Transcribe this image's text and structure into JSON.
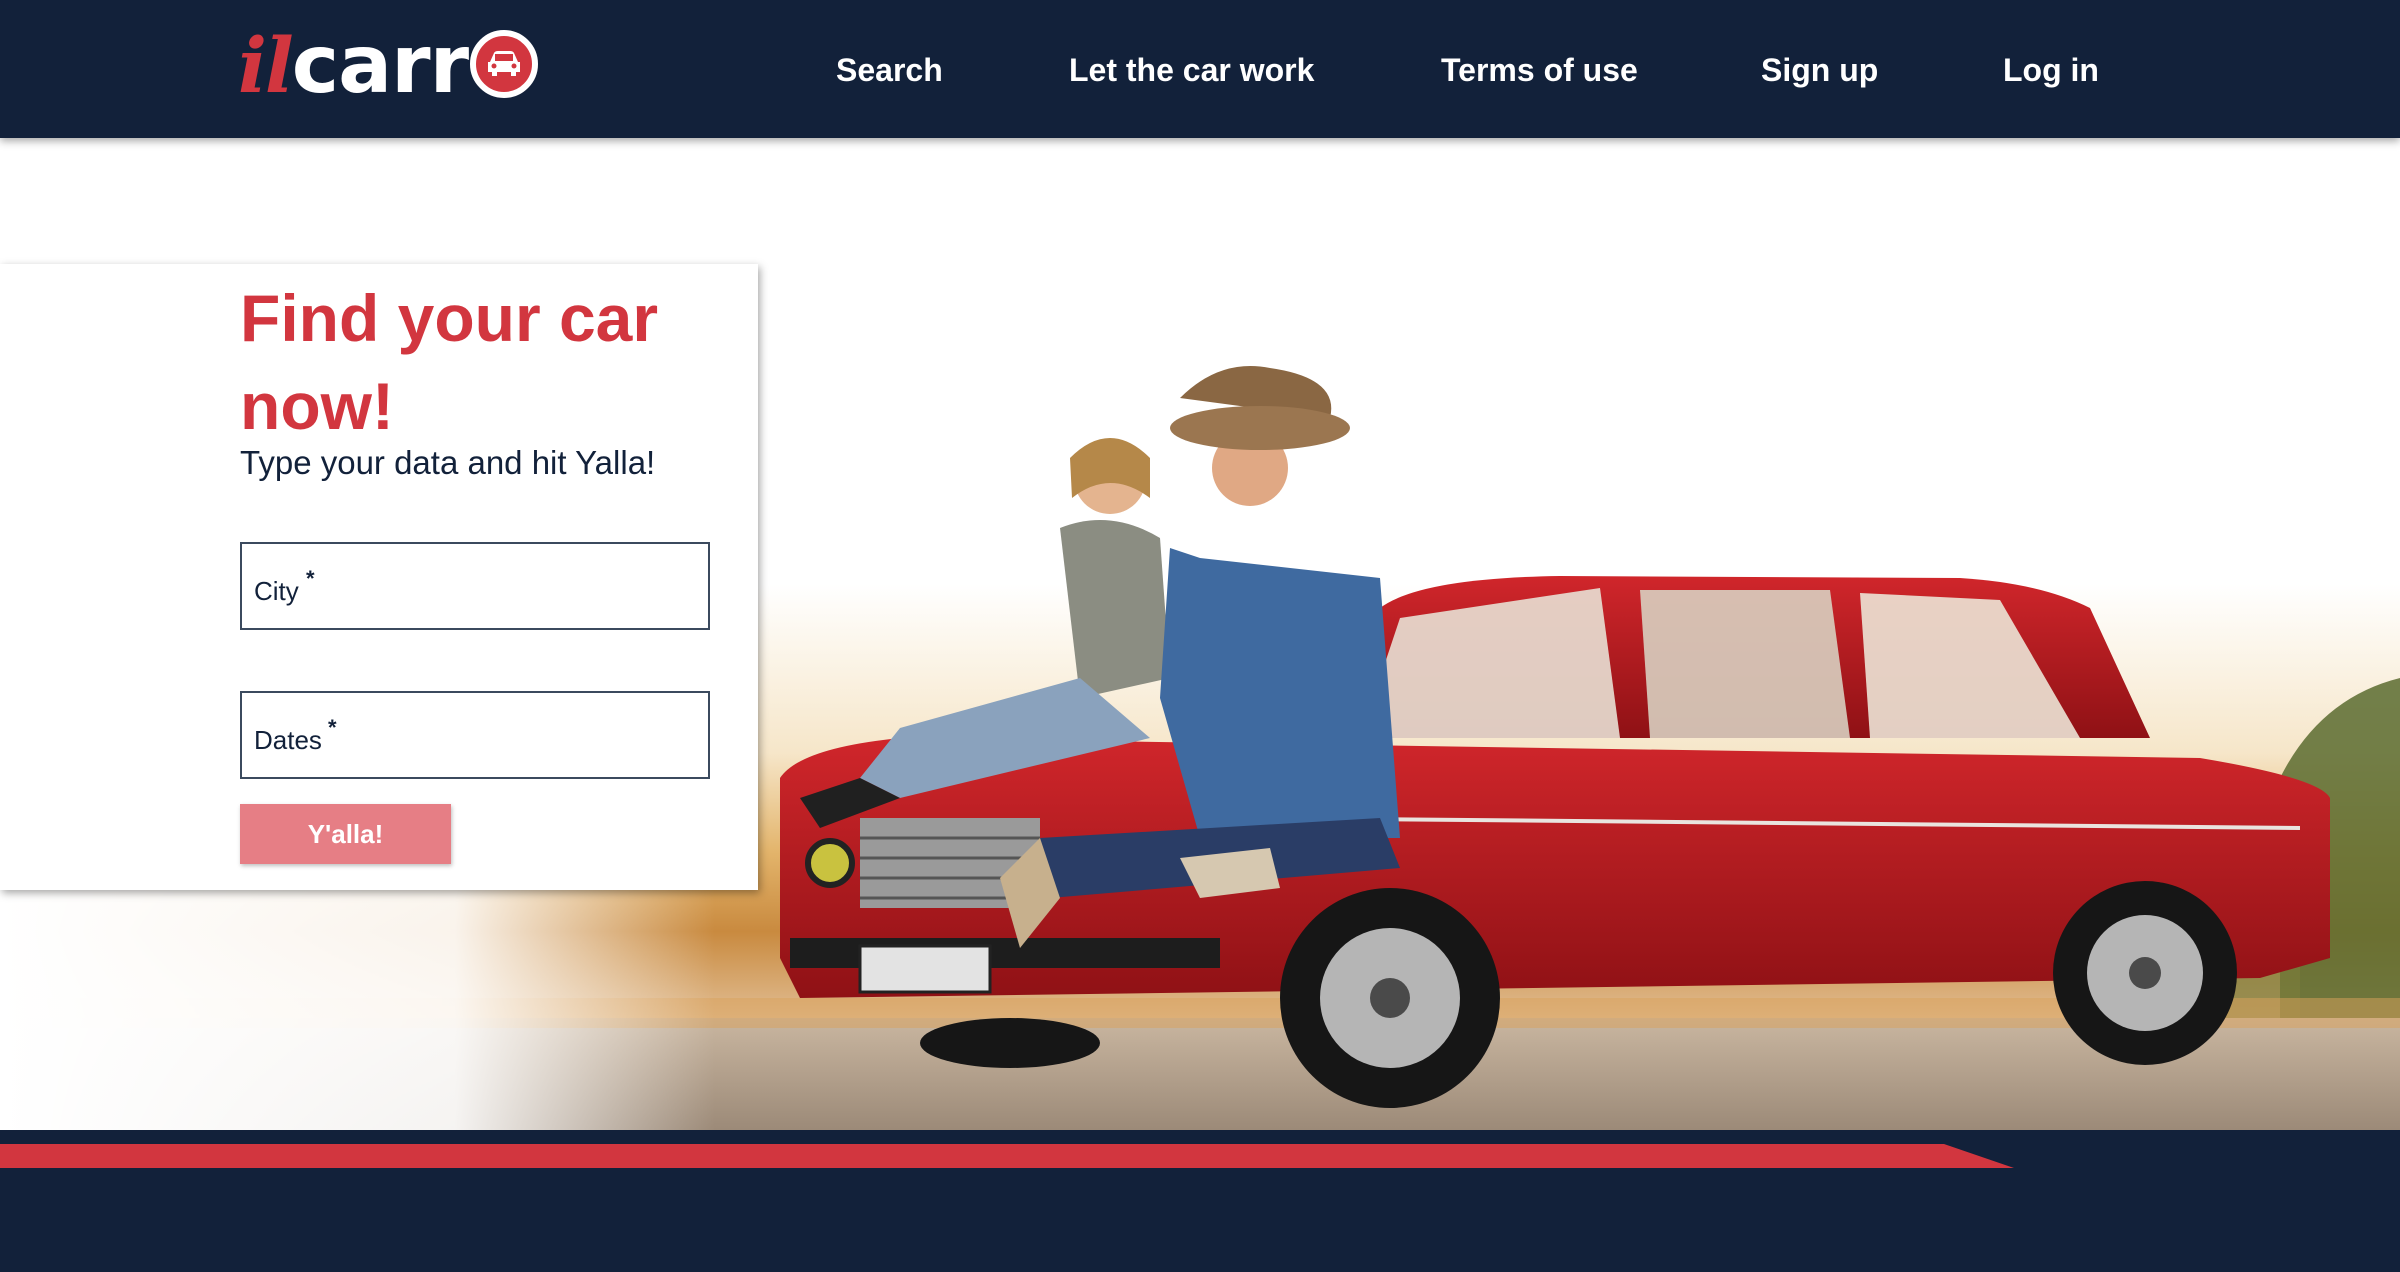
{
  "logo": {
    "il": "il",
    "carr": "carr"
  },
  "nav": {
    "search": "Search",
    "let_car_work": "Let the car work",
    "terms": "Terms of use",
    "signup": "Sign up",
    "login": "Log in"
  },
  "search_card": {
    "title": "Find your car now!",
    "subtitle": "Type your data and hit Yalla!",
    "city_label": "City",
    "dates_label": "Dates",
    "required_mark": "*",
    "submit_label": "Y'alla!"
  },
  "colors": {
    "navy": "#12213a",
    "brand_red": "#d2363f",
    "button_pink": "#e67e85",
    "car_red": "#b81a1f"
  },
  "icons": [
    "car-icon"
  ]
}
